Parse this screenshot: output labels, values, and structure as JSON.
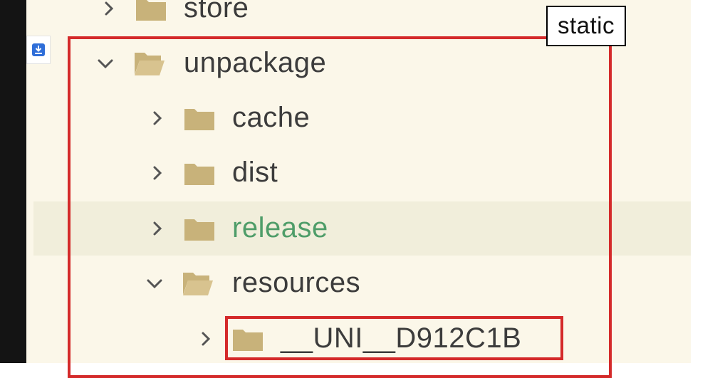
{
  "tree": {
    "items": [
      {
        "label": "store",
        "state": "collapsed",
        "icon": "folder-closed-icon"
      },
      {
        "label": "unpackage",
        "state": "expanded",
        "icon": "folder-open-icon"
      },
      {
        "label": "cache",
        "state": "collapsed",
        "icon": "folder-closed-icon"
      },
      {
        "label": "dist",
        "state": "collapsed",
        "icon": "folder-closed-icon"
      },
      {
        "label": "release",
        "state": "collapsed",
        "icon": "folder-closed-icon",
        "selected": true
      },
      {
        "label": "resources",
        "state": "expanded",
        "icon": "folder-open-icon"
      },
      {
        "label": "__UNI__D912C1B",
        "state": "collapsed",
        "icon": "folder-closed-icon"
      }
    ]
  },
  "tooltip": {
    "text": "static"
  },
  "side_button": {
    "icon": "download-icon"
  },
  "colors": {
    "panel_bg": "#fbf7e9",
    "selected_row_bg": "#f1eedb",
    "folder": "#c8b27a",
    "text": "#3c3c3c",
    "release_text": "#4f9d69",
    "highlight_box": "#d42a2a"
  }
}
